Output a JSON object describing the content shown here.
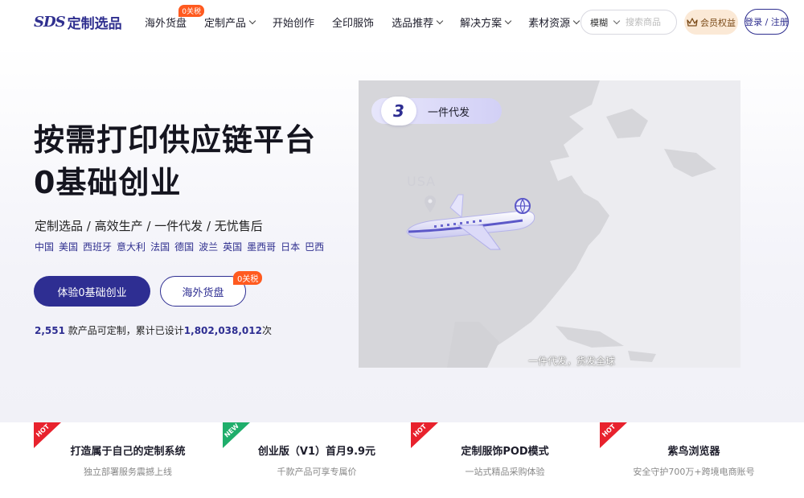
{
  "header": {
    "logo_mark": "SDS",
    "logo_text": "定制选品",
    "nav": [
      {
        "label": "海外货盘",
        "badge": "0关税",
        "dropdown": false
      },
      {
        "label": "定制产品",
        "dropdown": true
      },
      {
        "label": "开始创作",
        "dropdown": false
      },
      {
        "label": "全印服饰",
        "dropdown": false
      },
      {
        "label": "选品推荐",
        "dropdown": true
      },
      {
        "label": "解决方案",
        "dropdown": true
      },
      {
        "label": "素材资源",
        "dropdown": true
      }
    ],
    "search": {
      "mode": "模糊",
      "placeholder": "搜索商品"
    },
    "member_label": "会员权益",
    "login_label": "登录 / 注册"
  },
  "hero": {
    "title_line1": "按需打印供应链平台",
    "title_line2": "0基础创业",
    "subtitle": "定制选品 / 高效生产 / 一件代发 / 无忧售后",
    "countries": [
      "中国",
      "美国",
      "西班牙",
      "意大利",
      "法国",
      "德国",
      "波兰",
      "英国",
      "墨西哥",
      "日本",
      "巴西"
    ],
    "primary_button": "体验0基础创业",
    "secondary_button": "海外货盘",
    "secondary_badge": "0关税",
    "stats": {
      "product_count": "2,551",
      "product_text": " 款产品可定制，累计已设计",
      "design_count": "1,802,038,012",
      "design_suffix": "次"
    },
    "step": {
      "number": "3",
      "label": "一件代发"
    },
    "map_label": "USA",
    "map_caption": "一件代发，货发全球"
  },
  "cards": [
    {
      "tag": "HOT",
      "tag_color": "#e8222d",
      "title": "打造属于自己的定制系统",
      "desc": "独立部署服务震撼上线"
    },
    {
      "tag": "NEW",
      "tag_color": "#1fae6b",
      "title": "创业版（V1）首月9.9元",
      "desc": "千款产品可享专属价"
    },
    {
      "tag": "HOT",
      "tag_color": "#e8222d",
      "title": "定制服饰POD模式",
      "desc": "一站式精品采购体验"
    },
    {
      "tag": "HOT",
      "tag_color": "#e8222d",
      "title": "紫鸟浏览器",
      "desc": "安全守护700万+跨境电商账号"
    }
  ],
  "colors": {
    "brand": "#2e2e92",
    "badge": "#ff5a1f",
    "member_bg": "#fbe9d6"
  }
}
